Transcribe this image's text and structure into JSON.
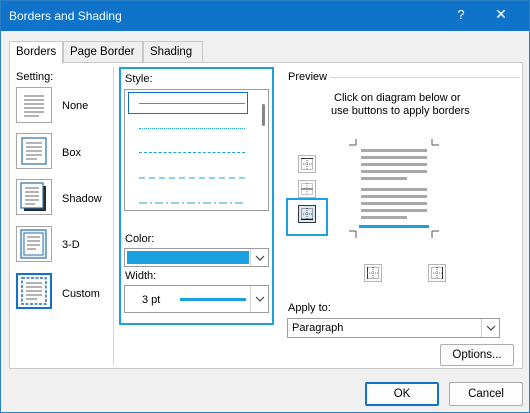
{
  "window": {
    "title": "Borders and Shading",
    "help_label": "?",
    "close_label": "✕"
  },
  "tabs": [
    {
      "label": "Borders",
      "active": true
    },
    {
      "label": "Page Border",
      "active": false
    },
    {
      "label": "Shading",
      "active": false
    }
  ],
  "setting": {
    "heading": "Setting:",
    "items": [
      {
        "label": "None",
        "icon": "setting-none-icon",
        "selected": false
      },
      {
        "label": "Box",
        "icon": "setting-box-icon",
        "selected": false
      },
      {
        "label": "Shadow",
        "icon": "setting-shadow-icon",
        "selected": false
      },
      {
        "label": "3-D",
        "icon": "setting-3d-icon",
        "selected": false
      },
      {
        "label": "Custom",
        "icon": "setting-custom-icon",
        "selected": true
      }
    ]
  },
  "style": {
    "heading": "Style:",
    "styles": [
      "solid",
      "dotted",
      "dashed-small",
      "dashed",
      "dash-dot"
    ],
    "selected_index": 0
  },
  "color": {
    "heading": "Color:",
    "value": "#1ba1e2"
  },
  "width": {
    "heading": "Width:",
    "value": "3 pt"
  },
  "preview": {
    "heading": "Preview",
    "instruction_line1": "Click on diagram below or",
    "instruction_line2": "use buttons to apply borders",
    "border_color": "#1ba1e2"
  },
  "apply_to": {
    "heading": "Apply to:",
    "value": "Paragraph"
  },
  "buttons": {
    "options": "Options...",
    "ok": "OK",
    "cancel": "Cancel"
  },
  "colors": {
    "accent": "#0e73c9",
    "highlight": "#1ba1e2"
  }
}
